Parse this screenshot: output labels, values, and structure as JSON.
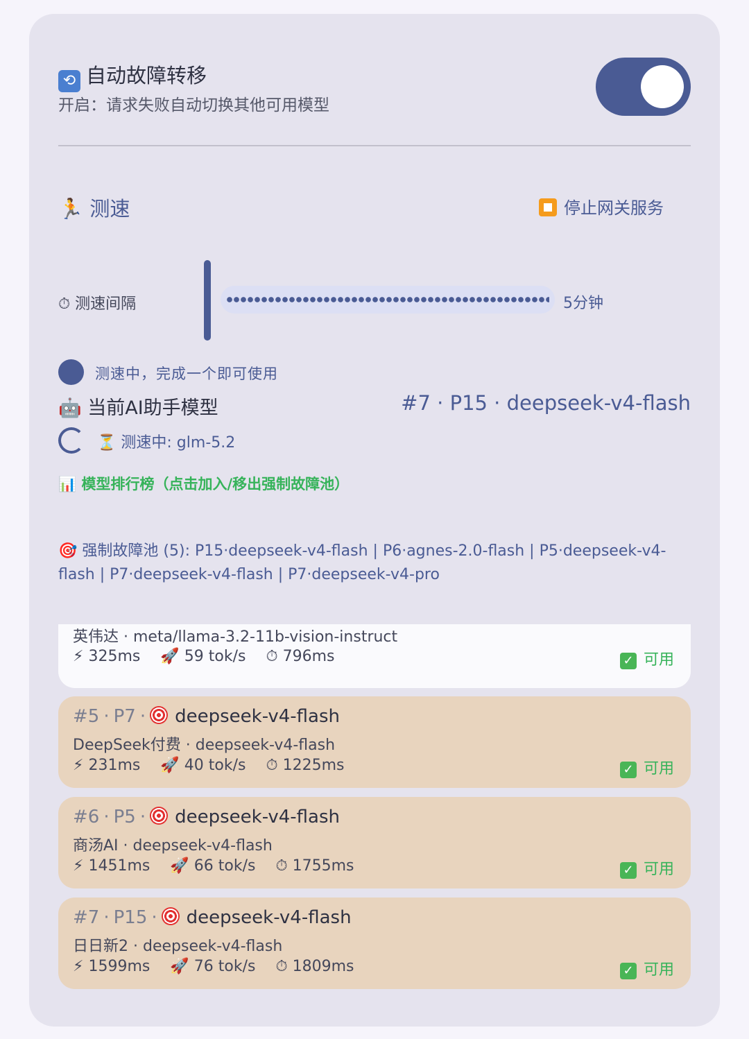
{
  "failover": {
    "icon": "🔄",
    "title": "自动故障转移",
    "subtitle": "开启：请求失败自动切换其他可用模型",
    "enabled": true
  },
  "speed": {
    "icon": "🏃",
    "title": "测速",
    "stop_label": "停止网关服务",
    "interval_icon": "⏱",
    "interval_label": "测速间隔",
    "interval_value": "5分钟",
    "status_text": "测速中，完成一个即可使用",
    "assistant_icon": "🤖",
    "assistant_label": "当前AI助手模型",
    "assistant_value": "#7 · P15 · deepseek-v4-flash",
    "testing_icon": "⏳",
    "testing_text": "测速中: glm-5.2"
  },
  "ranking": {
    "icon": "📊",
    "title": "模型排行榜（点击加入/移出强制故障池）",
    "pool_icon": "🎯",
    "pool_text": "强制故障池 (5): P15·deepseek-v4-flash | P6·agnes-2.0-flash | P5·deepseek-v4-flash | P7·deepseek-v4-flash | P7·deepseek-v4-pro",
    "partial_card": {
      "provider": "英伟达 · meta/llama-3.2-11b-vision-instruct",
      "latency": "325ms",
      "speed": "59 tok/s",
      "total": "796ms",
      "status": "可用"
    },
    "cards": [
      {
        "rank": "#5",
        "priority": "P7",
        "model": "deepseek-v4-flash",
        "provider": "DeepSeek付费 · deepseek-v4-flash",
        "latency": "231ms",
        "speed": "40 tok/s",
        "total": "1225ms",
        "status": "可用"
      },
      {
        "rank": "#6",
        "priority": "P5",
        "model": "deepseek-v4-flash",
        "provider": "商汤AI · deepseek-v4-flash",
        "latency": "1451ms",
        "speed": "66 tok/s",
        "total": "1755ms",
        "status": "可用"
      },
      {
        "rank": "#7",
        "priority": "P15",
        "model": "deepseek-v4-flash",
        "provider": "日日新2 · deepseek-v4-flash",
        "latency": "1599ms",
        "speed": "76 tok/s",
        "total": "1809ms",
        "status": "可用"
      }
    ]
  },
  "icons": {
    "latency": "⚡",
    "speed": "🚀",
    "total": "⏱",
    "ok": "✓"
  },
  "colors": {
    "accent": "#4a5b94",
    "success": "#36b35a",
    "card_highlight": "#e8d4be",
    "panel": "#e5e3ee"
  }
}
